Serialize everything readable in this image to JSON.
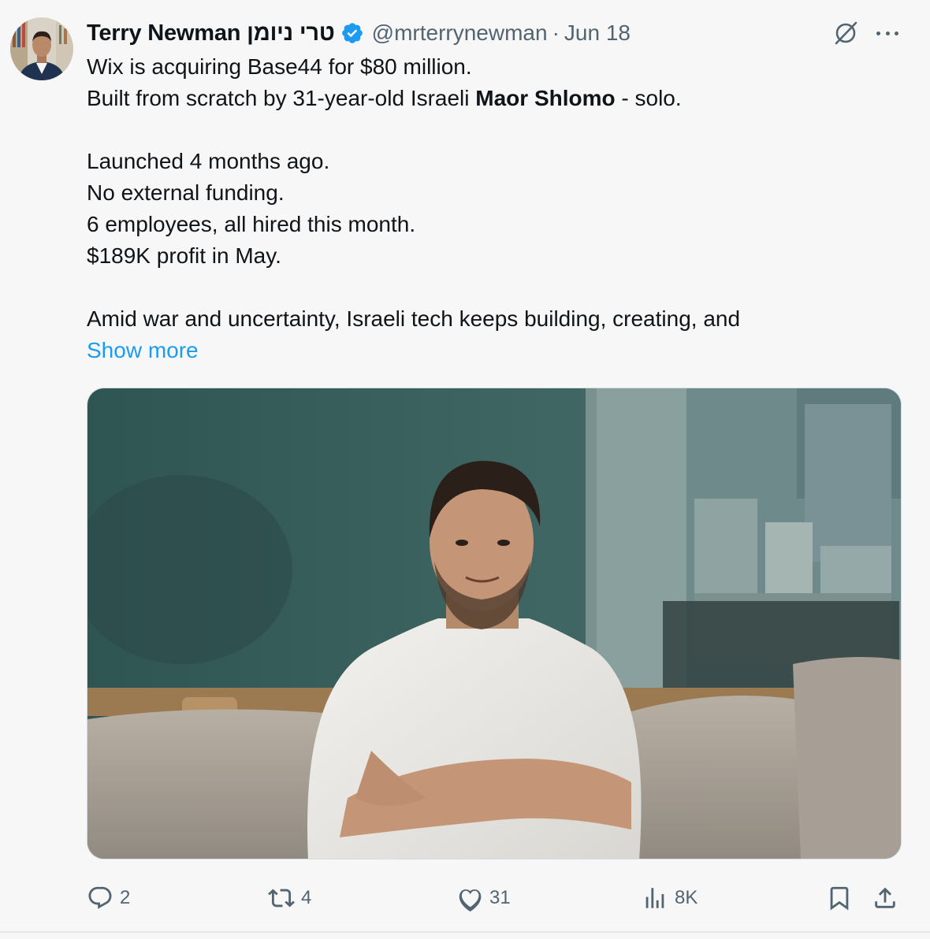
{
  "author": {
    "name": "Terry Newman",
    "hebrew_name": "טרי ניומן",
    "handle": "@mrterrynewman",
    "separator": "·",
    "date": "Jun 18"
  },
  "tweet": {
    "lines": [
      "Wix is acquiring Base44 for $80 million.",
      "Built from scratch by 31-year-old Israeli ",
      "Maor Shlomo",
      " - solo.",
      "Launched 4 months ago.",
      "No external funding.",
      "6 employees, all hired this month.",
      "$189K profit in May.",
      "Amid war and uncertainty, Israeli tech keeps building, creating, and"
    ],
    "show_more": "Show more"
  },
  "metrics": {
    "replies": "2",
    "reposts": "4",
    "likes": "31",
    "views": "8K"
  },
  "colors": {
    "link": "#1d9bf0",
    "verified": "#1d9bf0",
    "secondary_text": "#536471"
  },
  "icons": {
    "grok": "grok-icon",
    "more": "more-icon",
    "reply": "reply-icon",
    "repost": "repost-icon",
    "like": "heart-icon",
    "views": "views-chart-icon",
    "bookmark": "bookmark-icon",
    "share": "share-icon",
    "verified": "verified-badge-icon"
  }
}
